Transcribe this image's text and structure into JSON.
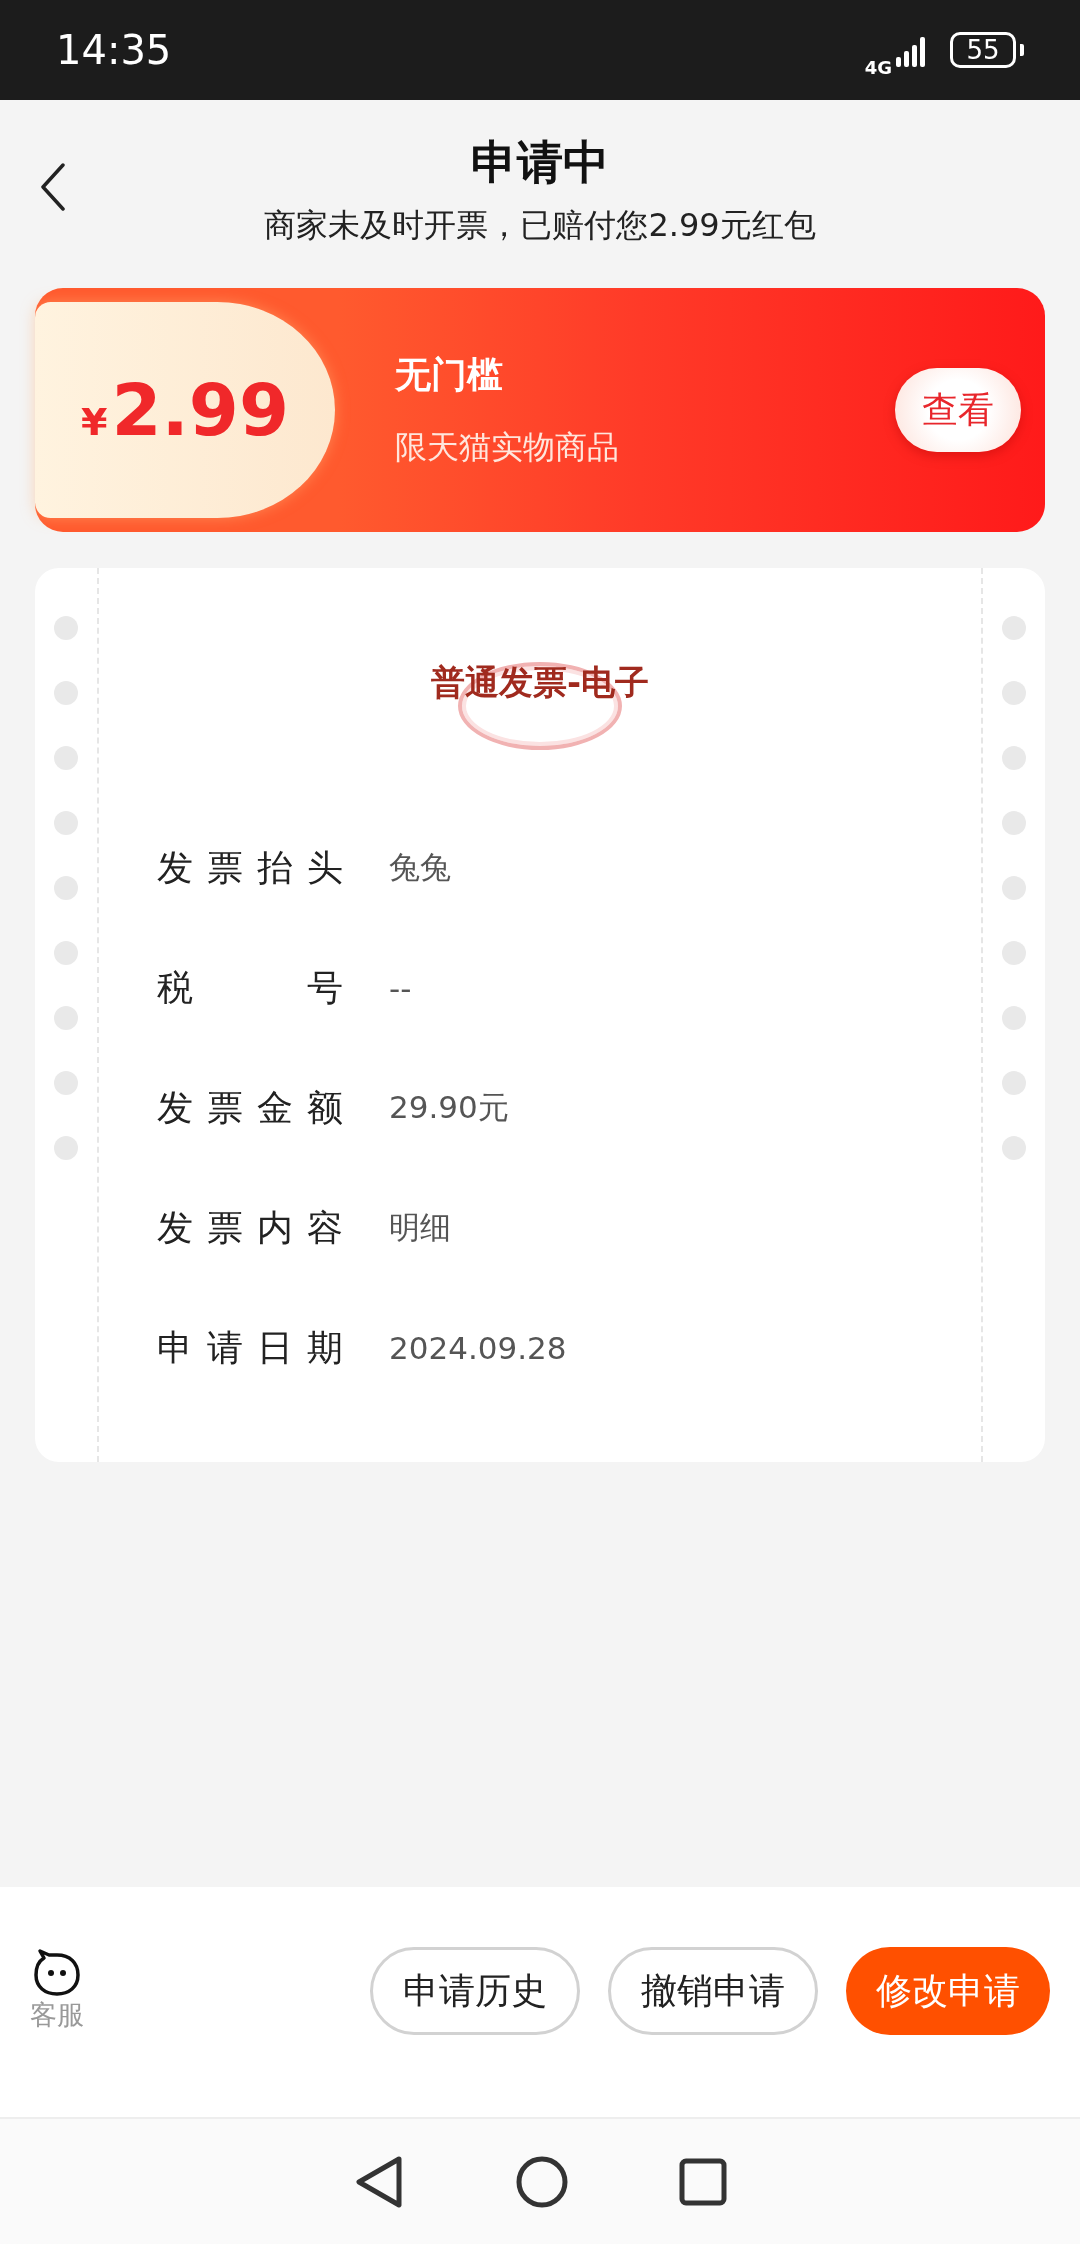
{
  "status_bar": {
    "time": "14:35",
    "network": "4G",
    "battery": "55"
  },
  "header": {
    "title": "申请中",
    "subtitle": "商家未及时开票，已赔付您2.99元红包"
  },
  "coupon": {
    "currency": "¥",
    "amount": "2.99",
    "title": "无门槛",
    "description": "限天猫实物商品",
    "button": "查看"
  },
  "invoice": {
    "type": "普通发票-电子",
    "fields": [
      {
        "label": "发票抬头",
        "value": "兔兔"
      },
      {
        "label": "税号",
        "value": "--"
      },
      {
        "label": "发票金额",
        "value": "29.90元"
      },
      {
        "label": "发票内容",
        "value": "明细"
      },
      {
        "label": "申请日期",
        "value": "2024.09.28"
      }
    ]
  },
  "bottom_bar": {
    "service": "客服",
    "buttons": [
      {
        "label": "申请历史",
        "kind": "outline"
      },
      {
        "label": "撤销申请",
        "kind": "outline"
      },
      {
        "label": "修改申请",
        "kind": "primary"
      }
    ]
  }
}
